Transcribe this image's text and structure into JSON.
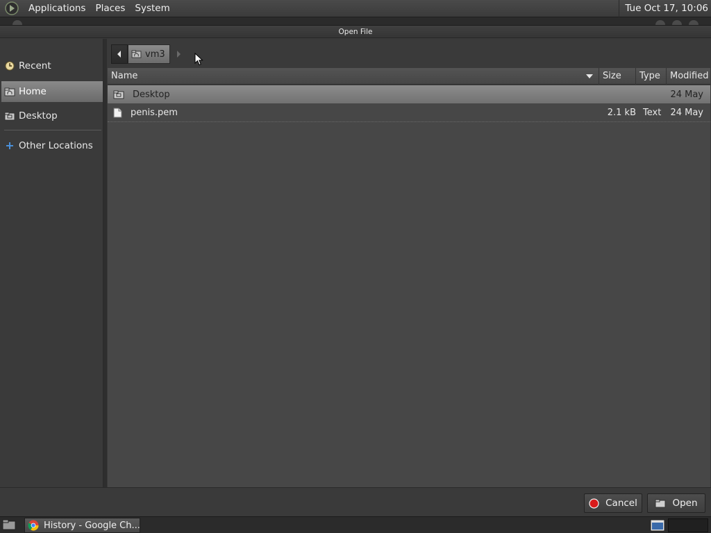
{
  "top_panel": {
    "menus": [
      "Applications",
      "Places",
      "System"
    ],
    "clock": "Tue Oct 17, 10:06",
    "logo_icon": "gnome-foot-icon"
  },
  "dialog": {
    "title": "Open File",
    "sidebar": [
      {
        "label": "Recent",
        "icon": "recent-clock-icon",
        "selected": false
      },
      {
        "label": "Home",
        "icon": "home-folder-icon",
        "selected": true
      },
      {
        "label": "Desktop",
        "icon": "desktop-folder-icon",
        "selected": false
      },
      {
        "label": "Other Locations",
        "icon": "plus-icon",
        "selected": false
      }
    ],
    "pathbar": {
      "crumb": "vm3"
    },
    "columns": {
      "name": "Name",
      "size": "Size",
      "type": "Type",
      "modified": "Modified"
    },
    "files": [
      {
        "name": "Desktop",
        "size": "",
        "type": "",
        "modified": "24 May",
        "icon": "folder-icon",
        "selected": true
      },
      {
        "name": "penis.pem",
        "size": "2.1 kB",
        "type": "Text",
        "modified": "24 May",
        "icon": "text-file-icon",
        "selected": false
      }
    ],
    "buttons": {
      "cancel": "Cancel",
      "open": "Open"
    }
  },
  "taskbar": {
    "task": "History - Google Ch..."
  },
  "colors": {
    "panel": "#3b3b3b",
    "selection": "#7a7a7a",
    "cancel_red": "#d81b1b"
  }
}
